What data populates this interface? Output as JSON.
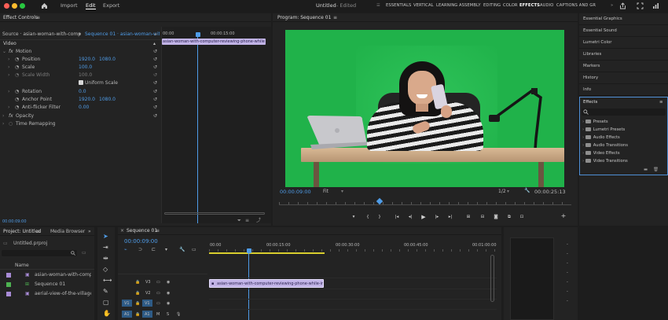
{
  "app": {
    "nav": {
      "import": "Import",
      "edit": "Edit",
      "export": "Export"
    },
    "title": "Untitled",
    "status": "- Edited",
    "workspaces": [
      "ESSENTIALS",
      "VERTICAL",
      "LEARNING",
      "ASSEMBLY",
      "EDITING",
      "COLOR",
      "EFFECTS",
      "AUDIO",
      "CAPTIONS AND GR"
    ],
    "active_workspace": "EFFECTS"
  },
  "effect_controls": {
    "tab": "Effect Controls",
    "source": "Source · asian-woman-with-compu",
    "sequence": "Sequence 01 · asian-woman-wit...",
    "section": "Video",
    "fx_motion": "Motion",
    "position": {
      "label": "Position",
      "x": "1920.0",
      "y": "1080.0"
    },
    "scale": {
      "label": "Scale",
      "value": "100.0"
    },
    "scale_width": {
      "label": "Scale Width",
      "value": "100.0"
    },
    "uniform": "Uniform Scale",
    "rotation": {
      "label": "Rotation",
      "value": "0.0"
    },
    "anchor": {
      "label": "Anchor Point",
      "x": "1920.0",
      "y": "1080.0"
    },
    "flicker": {
      "label": "Anti-flicker Filter",
      "value": "0.00"
    },
    "opacity": "Opacity",
    "remap": "Time Remapping",
    "ruler": {
      "start": "00:00",
      "mid": "00:00:15:00"
    },
    "clip": "asian-woman-with-computer-reviewing-phone-while",
    "timecode": "00:00:09:00"
  },
  "program": {
    "title": "Program: Sequence 01",
    "timecode": "00:00:09:00",
    "fit": "Fit",
    "quality": "1/2",
    "duration": "00:00:25:13"
  },
  "right_panels": [
    "Essential Graphics",
    "Essential Sound",
    "Lumetri Color",
    "Libraries",
    "Markers",
    "History",
    "Info"
  ],
  "effects": {
    "title": "Effects",
    "items": [
      "Presets",
      "Lumetri Presets",
      "Audio Effects",
      "Audio Transitions",
      "Video Effects",
      "Video Transitions"
    ]
  },
  "project": {
    "tab": "Project: Untitled",
    "tab2": "Media Browser",
    "file": "Untitled.prproj",
    "col_name": "Name",
    "items": [
      {
        "name": "asian-woman-with-compute",
        "color": "#a88bd6"
      },
      {
        "name": "Sequence 01",
        "color": "#4db251"
      },
      {
        "name": "aerial-view-of-the-village-in",
        "color": "#a88bd6"
      }
    ]
  },
  "timeline": {
    "tab": "Sequence 01",
    "timecode": "00:00:09:00",
    "ruler": [
      "00:00",
      "00:00:15:00",
      "00:00:30:00",
      "00:00:45:00",
      "00:01:00:00"
    ],
    "tracks": [
      "V3",
      "V2",
      "V1",
      "A1"
    ],
    "src_v": "V1",
    "src_a": "A1",
    "clip": "asian-woman-with-computer-reviewing-phone-while-in-2022-0"
  },
  "colors": {
    "accent": "#4f9ce8",
    "green": "#20b24a",
    "clip": "#c1b3e6"
  },
  "icons": [
    "home-icon",
    "share-icon",
    "fullscreen-icon",
    "menu-icon",
    "search-icon",
    "folder-icon",
    "play-icon",
    "wrench-icon",
    "camera-icon",
    "selection-tool-icon"
  ]
}
